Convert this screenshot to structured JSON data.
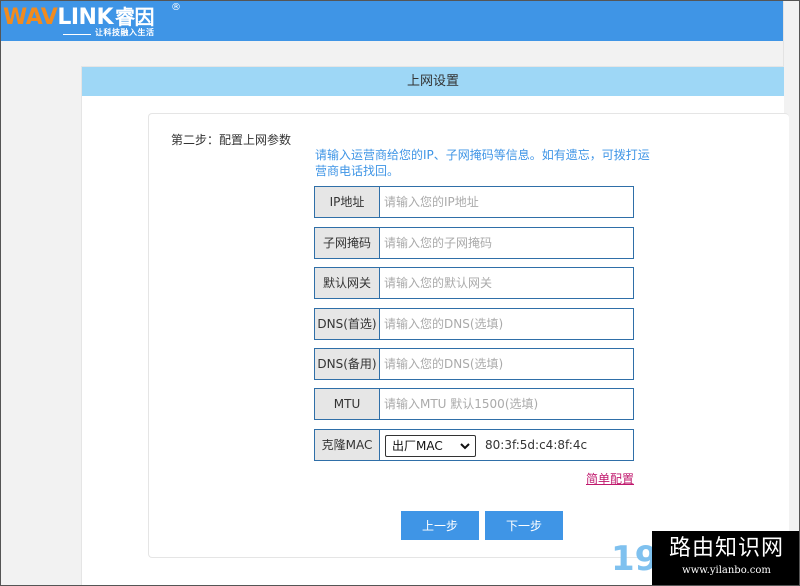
{
  "header": {
    "logo": {
      "brand_w": "WAV",
      "brand_link": "LINK",
      "brand_cn": "睿因",
      "registered": "®",
      "slogan": "让科技融入生活"
    },
    "accent_color": "#3f95e6"
  },
  "panel": {
    "title": "上网设置",
    "step_title": "第二步：配置上网参数",
    "hint": "请输入运营商给您的IP、子网掩码等信息。如有遗忘，可拨打运营商电话找回。",
    "fields": [
      {
        "label": "IP地址",
        "placeholder": "请输入您的IP地址",
        "value": ""
      },
      {
        "label": "子网掩码",
        "placeholder": "请输入您的子网掩码",
        "value": ""
      },
      {
        "label": "默认网关",
        "placeholder": "请输入您的默认网关",
        "value": ""
      },
      {
        "label": "DNS(首选)",
        "placeholder": "请输入您的DNS(选填)",
        "value": ""
      },
      {
        "label": "DNS(备用)",
        "placeholder": "请输入您的DNS(选填)",
        "value": ""
      },
      {
        "label": "MTU",
        "placeholder": "请输入MTU 默认1500(选填)",
        "value": ""
      }
    ],
    "mac": {
      "label": "克隆MAC",
      "selected": "出厂MAC",
      "value": "80:3f:5d:c4:8f:4c"
    },
    "simple_config_link": "简单配置",
    "prev_button": "上一步",
    "next_button": "下一步"
  },
  "watermark": {
    "number": "19",
    "text": "路由知识网",
    "url": "www.yilanbo.com"
  },
  "icons": [
    "chevron-down-icon"
  ]
}
